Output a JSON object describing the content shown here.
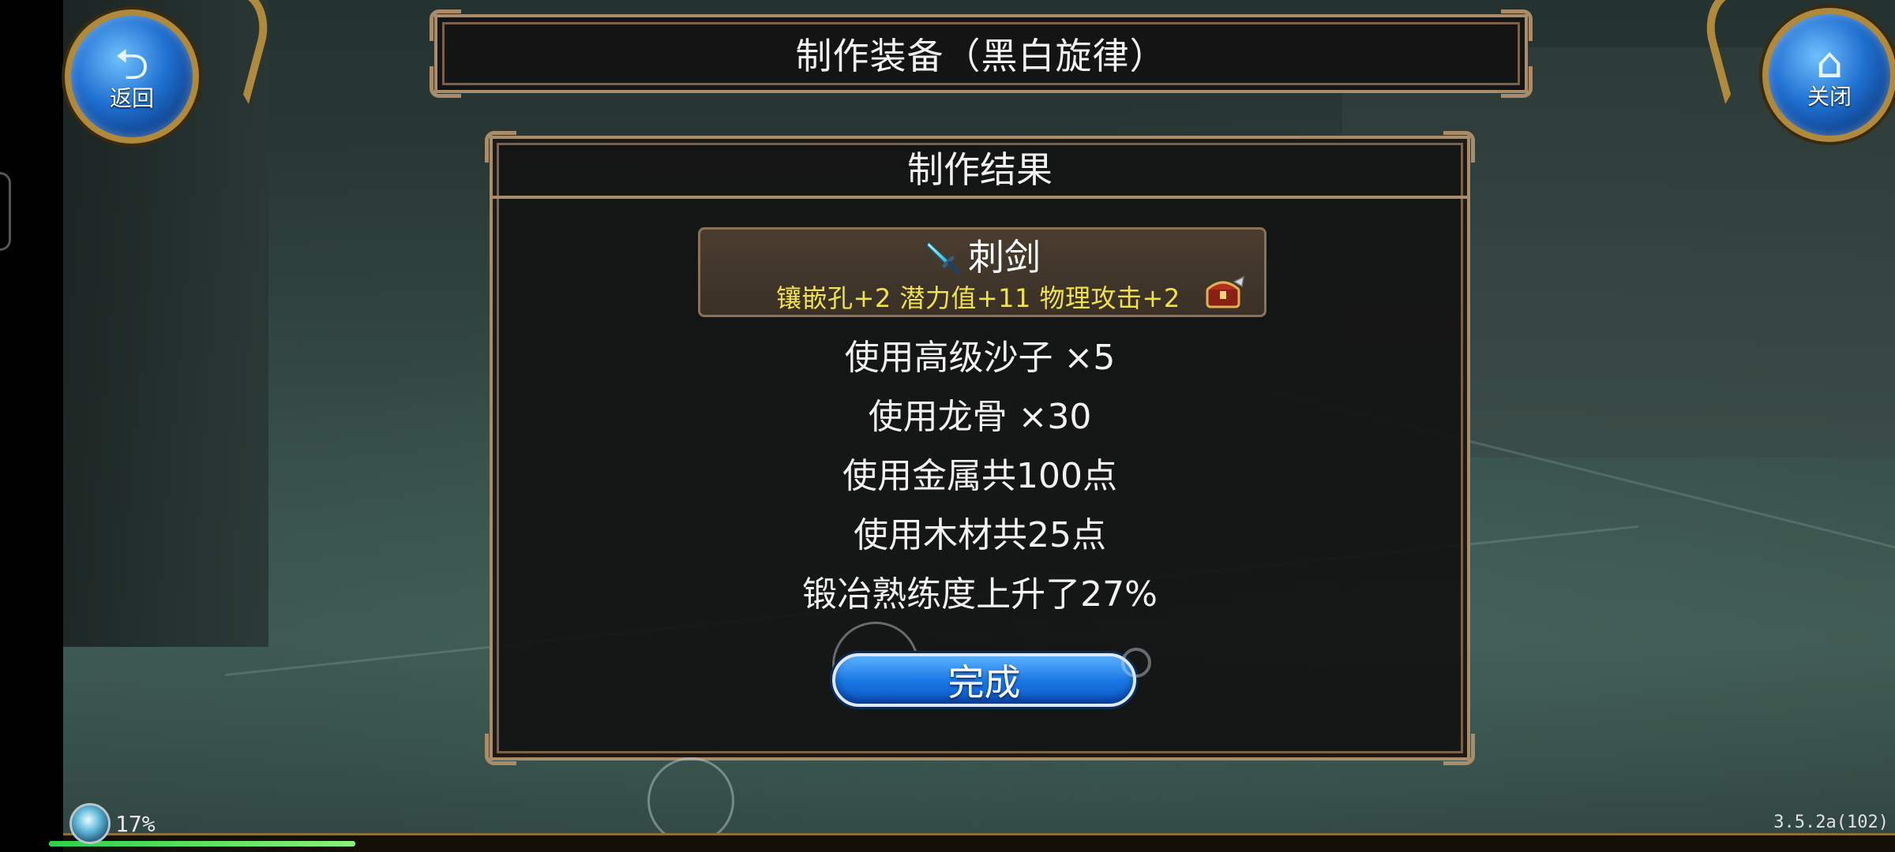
{
  "nav": {
    "back_label": "返回",
    "close_label": "关闭",
    "back_glyph": "⮌",
    "close_glyph": "⌂"
  },
  "title": "制作装备（黑白旋律）",
  "panel": {
    "header": "制作结果",
    "item": {
      "icon": "sword-icon",
      "name": "刺剑",
      "stats": "镶嵌孔+2 潜力值+11 物理攻击+2",
      "badge_icon": "treasure-chest-icon"
    },
    "lines": [
      "使用高级沙子 ×5",
      "使用龙骨 ×30",
      "使用金属共100点",
      "使用木材共25点",
      "锻冶熟练度上升了27%"
    ],
    "done_label": "完成"
  },
  "status": {
    "percent": "17%",
    "progress_fraction": 0.17,
    "version": "3.5.2a(102)"
  },
  "colors": {
    "frame": "#a98c6a",
    "stats_text": "#f0e24a",
    "button_blue": "#1b79e6",
    "progress_green": "#2dd04a"
  }
}
